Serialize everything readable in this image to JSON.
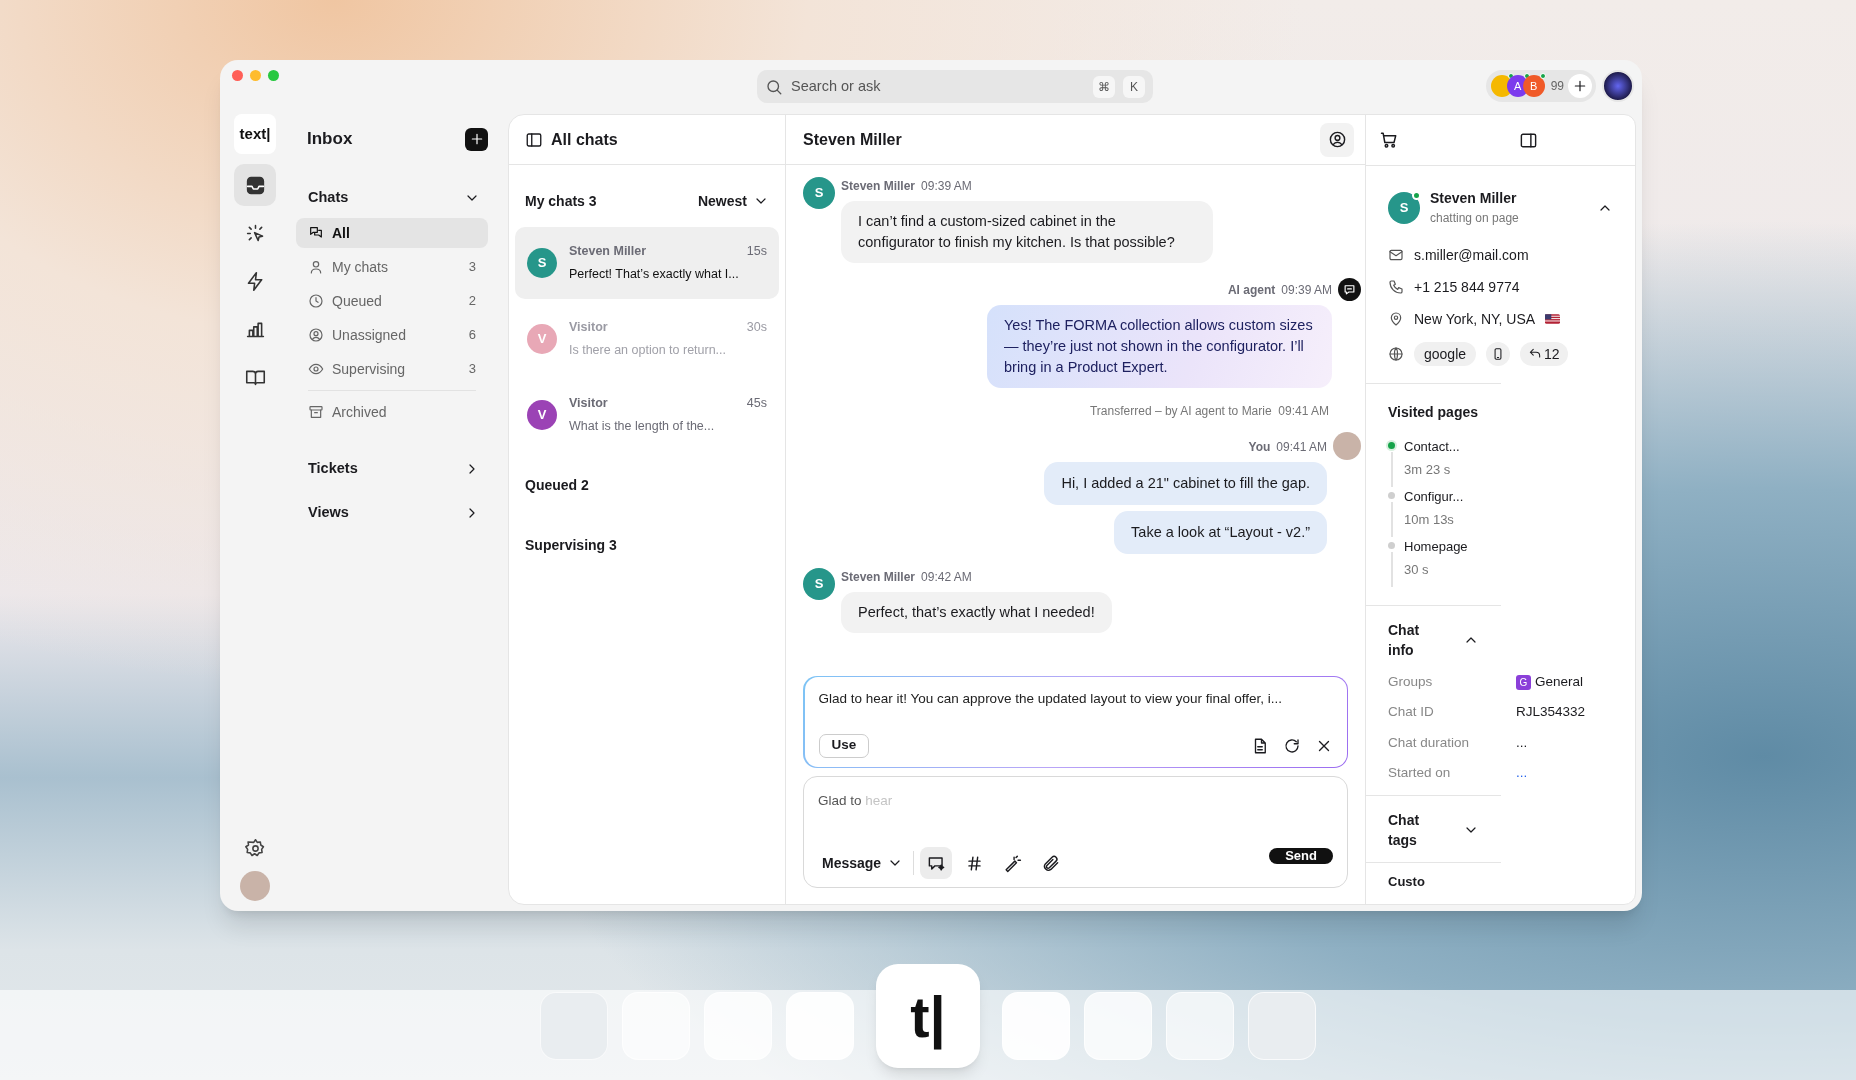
{
  "search": {
    "placeholder": "Search or ask",
    "keys": [
      "⌘",
      "K"
    ]
  },
  "topbar": {
    "avatars": [
      {
        "kind": "photo",
        "color": "#f5b800",
        "online": true
      },
      {
        "kind": "letter",
        "label": "A",
        "color": "#7c3aed",
        "online": true
      },
      {
        "kind": "letter",
        "label": "B",
        "color": "#f05a28",
        "online": true
      }
    ],
    "count": "99"
  },
  "rail": {
    "logo": "text|",
    "items": [
      {
        "selected": true
      },
      {
        "selected": false
      },
      {
        "selected": false
      },
      {
        "selected": false
      },
      {
        "selected": false
      }
    ]
  },
  "inbox": {
    "title": "Inbox",
    "sections": [
      {
        "label": "Chats",
        "expanded": true,
        "items": [
          {
            "label": "All",
            "selected": true
          },
          {
            "label": "My chats",
            "count": "3",
            "selected": false
          },
          {
            "label": "Queued",
            "count": "2",
            "selected": false
          },
          {
            "label": "Unassigned",
            "count": "6",
            "selected": false
          },
          {
            "label": "Supervising",
            "count": "3",
            "selected": false
          },
          {
            "label": "Archived",
            "selected": false,
            "separated": true
          }
        ]
      },
      {
        "label": "Tickets",
        "expanded": false
      },
      {
        "label": "Views",
        "expanded": false
      }
    ]
  },
  "chat_list": {
    "title": "All chats",
    "groups": [
      {
        "label": "My chats 3",
        "sort": "Newest",
        "chats": [
          {
            "name": "Steven Miller",
            "initial": "S",
            "color": "#26968a",
            "time": "15s",
            "preview": "Perfect! That’s exactly what I...",
            "selected": true,
            "muted": false
          },
          {
            "name": "Visitor",
            "initial": "V",
            "color": "#e8a8b6",
            "time": "30s",
            "preview": "Is there an option to return...",
            "selected": false,
            "muted": true
          },
          {
            "name": "Visitor",
            "initial": "V",
            "color": "#9b43b5",
            "time": "45s",
            "preview": "What is the length of the...",
            "selected": false,
            "muted": false
          }
        ]
      },
      {
        "label": "Queued 2"
      },
      {
        "label": "Supervising 3"
      }
    ]
  },
  "conversation": {
    "title": "Steven Miller",
    "messages": [
      {
        "kind": "customer",
        "author": "Steven Miller",
        "initial": "S",
        "time": "09:39 AM",
        "texts": [
          "I can’t find a custom-sized cabinet in the configurator to finish my kitchen. Is that possible?"
        ]
      },
      {
        "kind": "ai",
        "author": "AI agent",
        "time": "09:39 AM",
        "texts": [
          "Yes! The FORMA collection allows custom sizes — they’re just not shown in the configurator. I’ll bring in a Product Expert."
        ]
      },
      {
        "kind": "system",
        "text": "Transferred – by AI agent to Marie",
        "time": "09:41 AM"
      },
      {
        "kind": "agent",
        "author": "You",
        "time": "09:41 AM",
        "texts": [
          "Hi, I added a 21\" cabinet to fill the gap.",
          "Take a look at “Layout - v2.”"
        ]
      },
      {
        "kind": "customer",
        "author": "Steven Miller",
        "initial": "S",
        "time": "09:42 AM",
        "texts": [
          "Perfect, that’s exactly what I needed!"
        ]
      }
    ],
    "suggestion": {
      "text": "Glad to hear it! You can approve the updated layout to view your final offer, i...",
      "action": "Use"
    },
    "composer": {
      "value": "Glad to ",
      "ghost_text": "hear",
      "mode": "Message",
      "send": "Send"
    }
  },
  "details": {
    "name": "Steven Miller",
    "initial": "S",
    "online": true,
    "status": "chatting on page",
    "email": "s.miller@mail.com",
    "phone": "+1 215 844 9774",
    "location": "New York, NY, USA",
    "source": "google",
    "visits": "12",
    "visited_pages": {
      "title": "Visited pages",
      "pages": [
        {
          "title": "Contact...",
          "duration": "3m 23 s",
          "active": true
        },
        {
          "title": "Configur...",
          "duration": "10m 13s",
          "active": false
        },
        {
          "title": "Homepage",
          "duration": "30 s",
          "active": false
        }
      ]
    },
    "chat_info": {
      "title": "Chat info",
      "expanded": true,
      "rows": [
        {
          "label": "Groups",
          "value": "General",
          "badge": "G"
        },
        {
          "label": "Chat ID",
          "value": "RJL354332"
        },
        {
          "label": "Chat duration",
          "value": "..."
        },
        {
          "label": "Started on",
          "value": "...",
          "link": true
        }
      ]
    },
    "chat_tags": {
      "title": "Chat tags",
      "expanded": false
    },
    "next_section": "Custo"
  },
  "dock": [
    {
      "kind": "blank"
    },
    {
      "kind": "blank"
    },
    {
      "kind": "blank"
    },
    {
      "kind": "blank"
    },
    {
      "kind": "app",
      "label": "t|"
    },
    {
      "kind": "blank"
    },
    {
      "kind": "blank"
    },
    {
      "kind": "blank"
    },
    {
      "kind": "blank"
    }
  ]
}
